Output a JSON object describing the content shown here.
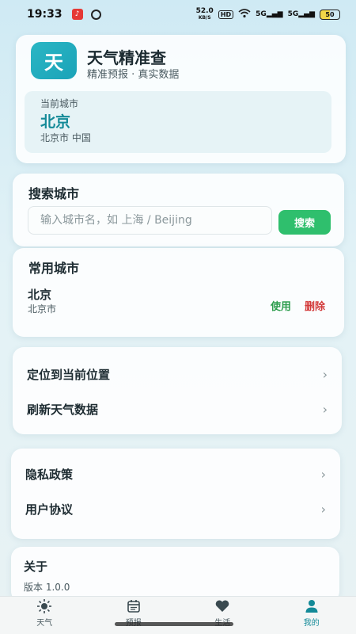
{
  "status_bar": {
    "time": "19:33",
    "net_speed_value": "52.0",
    "net_speed_unit": "KB/S",
    "hd": "HD",
    "signal_1": "5G",
    "signal_2": "5G",
    "battery": "50"
  },
  "header": {
    "logo_char": "天",
    "title": "天气精准查",
    "subtitle": "精准预报 · 真实数据",
    "current_city_caption": "当前城市",
    "current_city_name": "北京",
    "current_city_region": "北京市 中国"
  },
  "search": {
    "title": "搜索城市",
    "placeholder": "输入城市名，如 上海 / Beijing",
    "button_label": "搜索"
  },
  "favorites": {
    "title": "常用城市",
    "items": [
      {
        "name": "北京",
        "region": "北京市",
        "use_label": "使用",
        "delete_label": "删除"
      }
    ]
  },
  "actions": {
    "items": [
      {
        "label": "定位到当前位置"
      },
      {
        "label": "刷新天气数据"
      }
    ]
  },
  "legal": {
    "items": [
      {
        "label": "隐私政策"
      },
      {
        "label": "用户协议"
      }
    ]
  },
  "about": {
    "title": "关于",
    "version": "版本 1.0.0"
  },
  "tabs": [
    {
      "label": "天气",
      "icon": "sun-icon"
    },
    {
      "label": "预报",
      "icon": "calendar-icon"
    },
    {
      "label": "生活",
      "icon": "heart-icon"
    },
    {
      "label": "我的",
      "icon": "person-icon",
      "active": true
    }
  ],
  "colors": {
    "accent": "#138a98",
    "search_button": "#2fbf6d",
    "use_action": "#2f9e4f",
    "delete_action": "#d33b3b"
  }
}
